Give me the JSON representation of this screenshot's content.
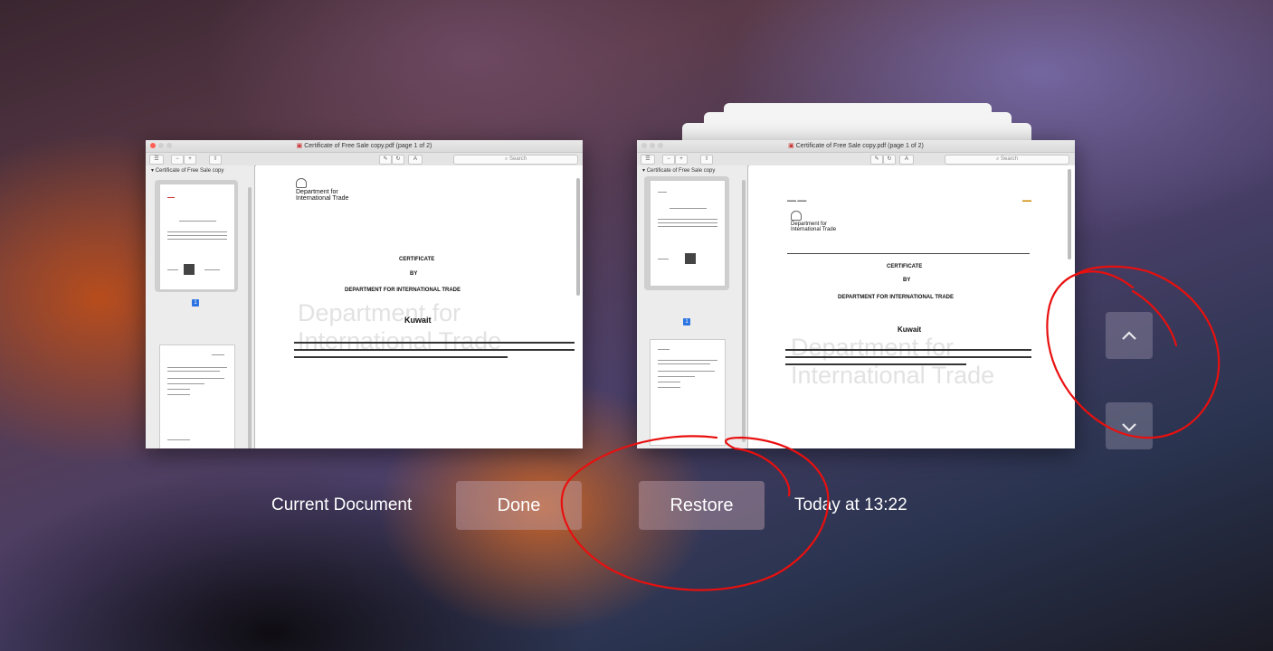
{
  "left_window": {
    "title": "Certificate of Free Sale copy.pdf (page 1 of 2)",
    "sidebar_header": "Certificate of Free Sale copy",
    "search_placeholder": "Search",
    "page_badge": "1"
  },
  "right_window": {
    "title": "Certificate of Free Sale copy.pdf (page 1 of 2)",
    "sidebar_header": "Certificate of Free Sale copy",
    "search_placeholder": "Search",
    "page_badge": "1"
  },
  "document": {
    "dept_line1": "Department for",
    "dept_line2": "International Trade",
    "heading1": "CERTIFICATE",
    "heading2": "BY",
    "heading3": "DEPARTMENT FOR INTERNATIONAL TRADE",
    "country": "Kuwait",
    "watermark_line1": "Department for",
    "watermark_line2": "International Trade"
  },
  "footer": {
    "current_label": "Current Document",
    "done_label": "Done",
    "restore_label": "Restore",
    "timestamp": "Today at 13:22"
  },
  "nav": {
    "up_icon": "chevron-up-icon",
    "down_icon": "chevron-down-icon"
  },
  "colors": {
    "annotation": "#e8100f",
    "page_badge": "#2b74e2"
  }
}
